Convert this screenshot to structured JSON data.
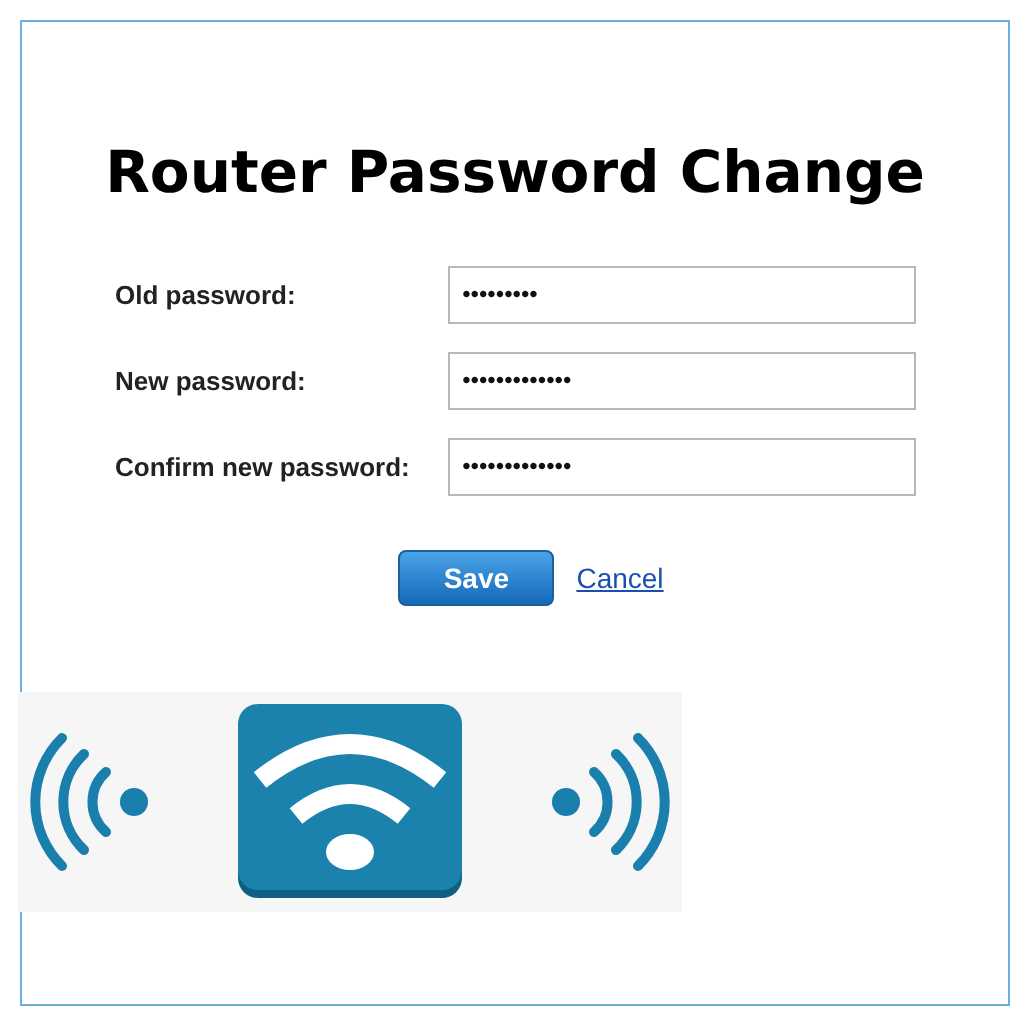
{
  "title": "Router Password Change",
  "fields": [
    {
      "label": "Old password:",
      "value": "•••••••••"
    },
    {
      "label": "New password:",
      "value": "•••••••••••••"
    },
    {
      "label": "Confirm new password:",
      "value": "•••••••••••••"
    }
  ],
  "buttons": {
    "save": "Save",
    "cancel": "Cancel"
  }
}
